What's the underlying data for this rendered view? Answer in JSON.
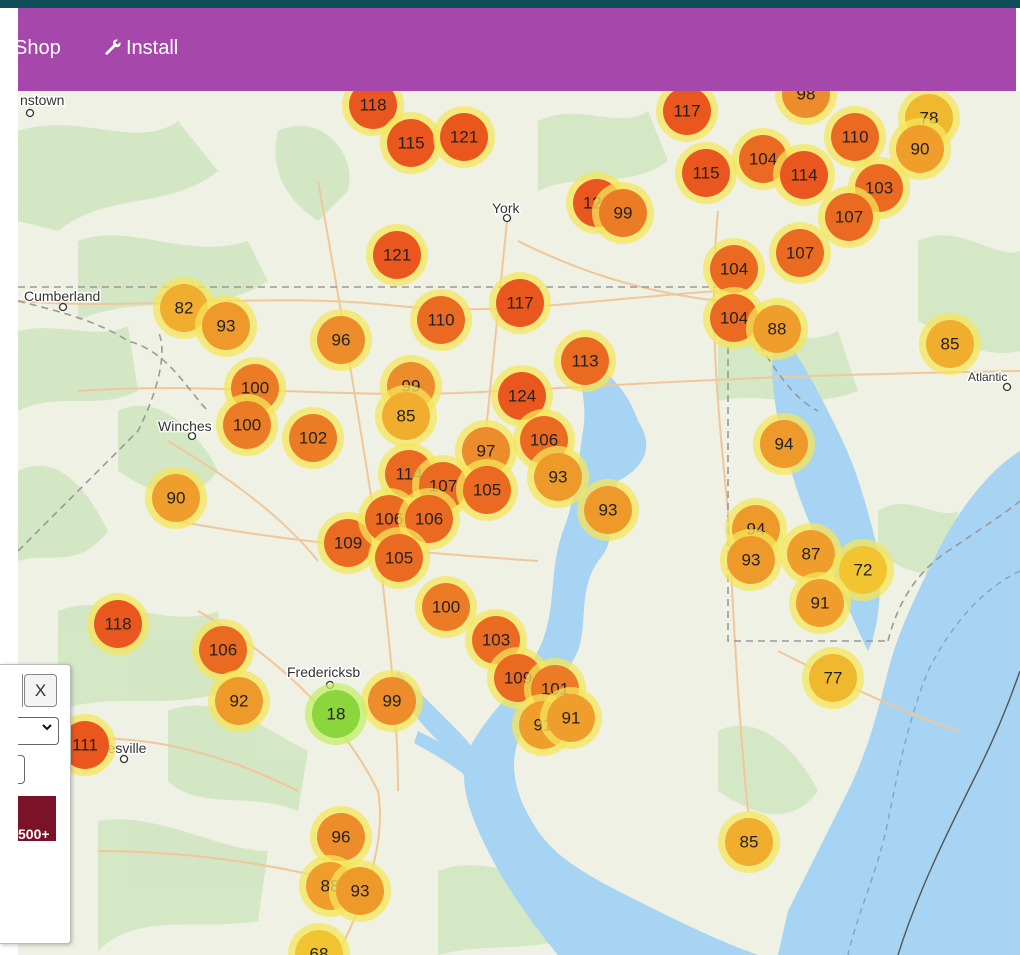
{
  "nav": {
    "items": [
      {
        "label": "Shop",
        "icon": ""
      },
      {
        "label": "Install",
        "icon": "wrench-icon"
      }
    ]
  },
  "map": {
    "places": [
      {
        "id": "johnstown",
        "label": "nstown"
      },
      {
        "id": "york",
        "label": "York"
      },
      {
        "id": "cumberland",
        "label": "Cumberland"
      },
      {
        "id": "winchester",
        "label": "Winches"
      },
      {
        "id": "fredericksburg",
        "label": "Fredericksb"
      },
      {
        "id": "charlottesville",
        "label": "ottesville"
      },
      {
        "id": "atlantic",
        "label": "Atlantic"
      }
    ],
    "clusters": [
      {
        "value": "118",
        "color": "#e9571e"
      },
      {
        "value": "115",
        "color": "#e9571e"
      },
      {
        "value": "121",
        "color": "#e9571e"
      },
      {
        "value": "117",
        "color": "#e9571e"
      },
      {
        "value": "98",
        "color": "#ec8c2a"
      },
      {
        "value": "78",
        "color": "#f0b82c"
      },
      {
        "value": "110",
        "color": "#ea6a22"
      },
      {
        "value": "90",
        "color": "#ef9e2c"
      },
      {
        "value": "104",
        "color": "#ea6a22"
      },
      {
        "value": "115",
        "color": "#e9571e"
      },
      {
        "value": "114",
        "color": "#e9571e"
      },
      {
        "value": "103",
        "color": "#ea6a22"
      },
      {
        "value": "107",
        "color": "#ea6a22"
      },
      {
        "value": "122",
        "color": "#e9571e"
      },
      {
        "value": "99",
        "color": "#ec7b26"
      },
      {
        "value": "121",
        "color": "#e9571e"
      },
      {
        "value": "107",
        "color": "#ea6a22"
      },
      {
        "value": "104",
        "color": "#ea6a22"
      },
      {
        "value": "104",
        "color": "#ea6a22"
      },
      {
        "value": "88",
        "color": "#ef9e2c"
      },
      {
        "value": "82",
        "color": "#f0ad2e"
      },
      {
        "value": "93",
        "color": "#ee9a2b"
      },
      {
        "value": "96",
        "color": "#ec8c2a"
      },
      {
        "value": "110",
        "color": "#ea6a22"
      },
      {
        "value": "117",
        "color": "#e9571e"
      },
      {
        "value": "113",
        "color": "#ea6a22"
      },
      {
        "value": "85",
        "color": "#f0ad2e"
      },
      {
        "value": "100",
        "color": "#ec7b26"
      },
      {
        "value": "99",
        "color": "#ec8c2a"
      },
      {
        "value": "85",
        "color": "#f0ad2e"
      },
      {
        "value": "124",
        "color": "#e9571e"
      },
      {
        "value": "100",
        "color": "#ec7b26"
      },
      {
        "value": "102",
        "color": "#ec7b26"
      },
      {
        "value": "97",
        "color": "#ec8c2a"
      },
      {
        "value": "106",
        "color": "#ea6a22"
      },
      {
        "value": "94",
        "color": "#ee9a2b"
      },
      {
        "value": "90",
        "color": "#ef9e2c"
      },
      {
        "value": "114",
        "color": "#ea6a22"
      },
      {
        "value": "107",
        "color": "#ea6a22"
      },
      {
        "value": "105",
        "color": "#ea6a22"
      },
      {
        "value": "93",
        "color": "#ee9a2b"
      },
      {
        "value": "93",
        "color": "#ee9a2b"
      },
      {
        "value": "94",
        "color": "#ee9a2b"
      },
      {
        "value": "109",
        "color": "#ea6a22"
      },
      {
        "value": "106",
        "color": "#ea6a22"
      },
      {
        "value": "106",
        "color": "#ea6a22"
      },
      {
        "value": "87",
        "color": "#ef9e2c"
      },
      {
        "value": "93",
        "color": "#ee9a2b"
      },
      {
        "value": "72",
        "color": "#f2c530"
      },
      {
        "value": "105",
        "color": "#ea6a22"
      },
      {
        "value": "91",
        "color": "#ef9e2c"
      },
      {
        "value": "100",
        "color": "#ec7b26"
      },
      {
        "value": "118",
        "color": "#e9571e"
      },
      {
        "value": "106",
        "color": "#ea6a22"
      },
      {
        "value": "103",
        "color": "#ea6a22"
      },
      {
        "value": "109",
        "color": "#ea6a22"
      },
      {
        "value": "101",
        "color": "#ec7b26"
      },
      {
        "value": "77",
        "color": "#f0b82c"
      },
      {
        "value": "92",
        "color": "#ee9a2b"
      },
      {
        "value": "99",
        "color": "#ec8c2a"
      },
      {
        "value": "18",
        "color": "#8bd63c"
      },
      {
        "value": "111",
        "color": "#e9571e"
      },
      {
        "value": "91",
        "color": "#ef9e2c"
      },
      {
        "value": "91",
        "color": "#ef9e2c"
      },
      {
        "value": "96",
        "color": "#ec8c2a"
      },
      {
        "value": "85",
        "color": "#f0ad2e"
      },
      {
        "value": "88",
        "color": "#ef9e2c"
      },
      {
        "value": "93",
        "color": "#ee9a2b"
      },
      {
        "value": "68",
        "color": "#f2c530"
      }
    ]
  },
  "panel": {
    "close_label": "X",
    "legend_label": "500+",
    "legend_color": "#7a1228"
  },
  "colors": {
    "nav_bg": "#a547ab",
    "top_line": "#0e4d57",
    "water": "#a6d4f2",
    "land": "#eff2e6"
  }
}
